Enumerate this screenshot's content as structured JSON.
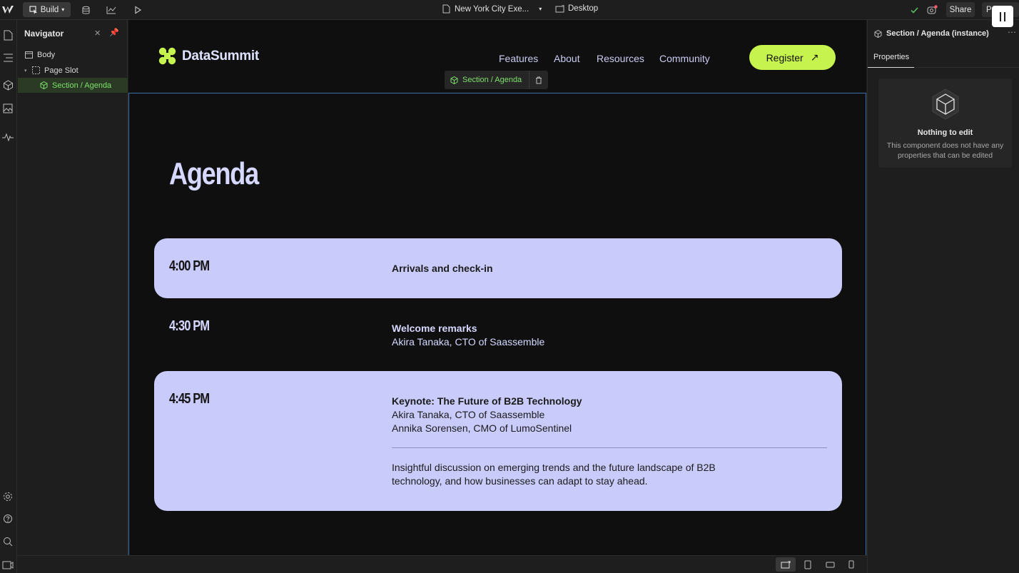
{
  "topbar": {
    "mode_label": "Build",
    "page_name": "New York City Exe...",
    "device_label": "Desktop",
    "share_label": "Share",
    "publish_label": "P"
  },
  "navigator": {
    "title": "Navigator",
    "tree": [
      {
        "label": "Body"
      },
      {
        "label": "Page Slot"
      },
      {
        "label": "Section / Agenda"
      }
    ]
  },
  "site": {
    "brand": "DataSummit",
    "nav": [
      "Features",
      "About",
      "Resources",
      "Community"
    ],
    "cta_label": "Register",
    "cta_arrow": "↗",
    "brand_color": "#c6f34d"
  },
  "selection_tag": {
    "label": "Section / Agenda"
  },
  "agenda": {
    "title": "Agenda",
    "items": [
      {
        "time": "4:00 PM",
        "title": "Arrivals and check-in"
      },
      {
        "time": "4:30 PM",
        "title": "Welcome remarks",
        "speakers": [
          "Akira Tanaka, CTO of Saassemble"
        ]
      },
      {
        "time": "4:45 PM",
        "title": "Keynote: The Future of B2B Technology",
        "speakers": [
          "Akira Tanaka, CTO of Saassemble",
          "Annika Sorensen, CMO of LumoSentinel"
        ],
        "description_lines": [
          "Insightful discussion on emerging trends and the future landscape of B2B",
          "technology, and how businesses can adapt to stay ahead."
        ]
      }
    ]
  },
  "right_panel": {
    "header": "Section / Agenda (instance)",
    "tab": "Properties",
    "empty_title": "Nothing to edit",
    "empty_desc": "This component does not have any properties that can be edited"
  }
}
